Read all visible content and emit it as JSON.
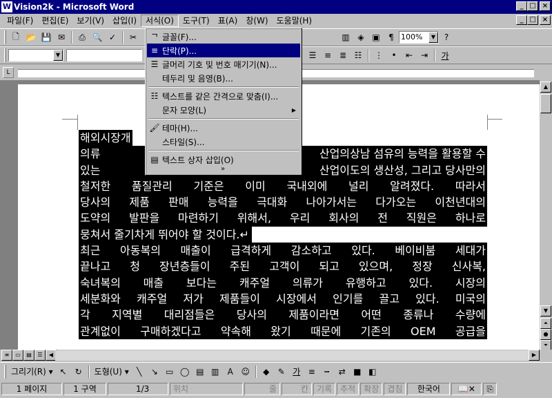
{
  "title_bar": {
    "title": "Vision2k - Microsoft Word",
    "app_icon": "W",
    "minimize": "_",
    "restore": "□",
    "close": "×"
  },
  "menu": {
    "items": [
      {
        "label": "파일(F)"
      },
      {
        "label": "편집(E)"
      },
      {
        "label": "보기(V)"
      },
      {
        "label": "삽입(I)"
      },
      {
        "label": "서식(O)"
      },
      {
        "label": "도구(T)"
      },
      {
        "label": "표(A)"
      },
      {
        "label": "창(W)"
      },
      {
        "label": "도움말(H)"
      }
    ],
    "active_index": 4
  },
  "toolbar": {
    "zoom": "100%",
    "font_size": "",
    "font_name": ""
  },
  "format_menu": {
    "items": [
      {
        "label": "글꼴(F)...",
        "icon": "font-icon"
      },
      {
        "label": "단락(P)...",
        "icon": "paragraph-icon",
        "selected": true
      },
      {
        "label": "글머리 기호 및 번호 매기기(N)...",
        "icon": "bullets-icon"
      },
      {
        "label": "테두리 및 음영(B)...",
        "icon": ""
      },
      {
        "label": "텍스트를 같은 간격으로 맞춤(I)...",
        "icon": "distribute-icon"
      },
      {
        "label": "문자 모양(L)",
        "icon": "",
        "submenu": true
      },
      {
        "label": "테마(H)...",
        "icon": "theme-icon"
      },
      {
        "label": "스타일(S)...",
        "icon": ""
      },
      {
        "label": "텍스트 상자 삽입(O)",
        "icon": "textbox-icon"
      }
    ],
    "more": "»"
  },
  "document": {
    "lines": [
      "해외시장개",
      "의류 산업의",
      "있는 산업이",
      "철저한 품질관리 기준은 이미 국내외에 널리 알려졌다. 따라서",
      "당사의 제품 판매 능력을 극대화 나아가서는 다가오는 이천년대의",
      "도약의 발판을 마련하기 위해서, 우리 회사의 전 직원은 하나로",
      "뭉쳐서 줄기차게 뛰어야 할 것이다.",
      "최근 아동복의 매출이 급격하게 감소하고 있다. 베이비붐 세대가",
      "끝나고 청 장년층들이 주된 고객이 되고 있으며, 정장 신사복,",
      "숙녀복의 매출 보다는 캐주얼 의류가 유행하고 있다. 시장의",
      "세분화와 캐주얼 저가 제품들이 시장에서 인기를 끌고 있다. 미국의",
      "각 지역별 대리점들은 당사의 제품이라면 어떤 종류나 수량에",
      "관계없이 구매하겠다고 약속해 왔기 때문에 기존의 OEM 공급을"
    ],
    "line1_tail": "상남 섬유의 능력을 활용할 수",
    "line2_tail": "도의 생산성, 그리고 당사만의",
    "paragraph_mark": "↵"
  },
  "drawing_toolbar": {
    "draw_label": "그리기(R) ▾",
    "autoshape_label": "도형(U) ▾"
  },
  "status_bar": {
    "page": "1 페이지",
    "section": "1 구역",
    "page_of": "1/3",
    "position": "위치",
    "line": "줄",
    "column": "칸",
    "rec": "기록",
    "trk": "추적",
    "ext": "확장",
    "ovr": "겹침",
    "language": "한국어"
  }
}
